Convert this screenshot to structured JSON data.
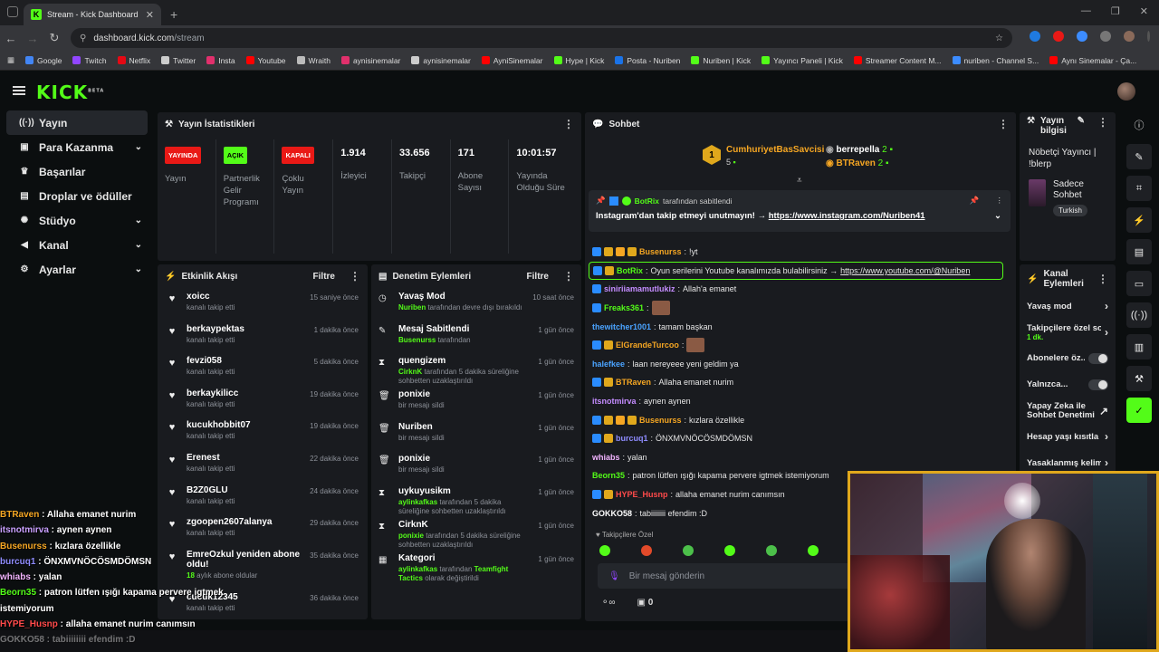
{
  "browser": {
    "tab_title": "Stream - Kick Dashboard",
    "tab_favicon": "K",
    "url_host": "dashboard.kick.com",
    "url_path": "/stream",
    "bookmarks": [
      {
        "label": "Google",
        "color": "#4285f4"
      },
      {
        "label": "Twitch",
        "color": "#9146ff"
      },
      {
        "label": "Netflix",
        "color": "#e50914"
      },
      {
        "label": "Twitter",
        "color": "#cccccc"
      },
      {
        "label": "Insta",
        "color": "#e1306c"
      },
      {
        "label": "Youtube",
        "color": "#ff0000"
      },
      {
        "label": "Wraith",
        "color": "#bbbbbb"
      },
      {
        "label": "aynisinemalar",
        "color": "#e1306c"
      },
      {
        "label": "aynisinemalar",
        "color": "#cccccc"
      },
      {
        "label": "AyniSinemalar",
        "color": "#ff0000"
      },
      {
        "label": "Hype | Kick",
        "color": "#53fc18"
      },
      {
        "label": "Posta - Nuriben",
        "color": "#1a73e8"
      },
      {
        "label": "Nuriben | Kick",
        "color": "#53fc18"
      },
      {
        "label": "Yayıncı Paneli | Kick",
        "color": "#53fc18"
      },
      {
        "label": "Streamer Content M...",
        "color": "#ff0000"
      },
      {
        "label": "nuriben - Channel S...",
        "color": "#3c8cff"
      },
      {
        "label": "Aynı Sinemalar - Ça...",
        "color": "#ff0000"
      }
    ]
  },
  "brand": {
    "logo": "KICK",
    "logo_sup": "BETA",
    "accent": "#53fc18"
  },
  "sidebar": {
    "items": [
      {
        "label": "Yayın",
        "icon": "broadcast-icon",
        "glyph": "((·))"
      },
      {
        "label": "Para Kazanma",
        "icon": "money-icon",
        "glyph": "▣"
      },
      {
        "label": "Başarılar",
        "icon": "trophy-icon",
        "glyph": "♛"
      },
      {
        "label": "Droplar ve ödüller",
        "icon": "gift-icon",
        "glyph": "▤"
      },
      {
        "label": "Stüdyo",
        "icon": "studio-icon",
        "glyph": "✺"
      },
      {
        "label": "Kanal",
        "icon": "channel-icon",
        "glyph": "◀"
      },
      {
        "label": "Ayarlar",
        "icon": "settings-icon",
        "glyph": "⚙"
      }
    ]
  },
  "stats": {
    "title": "Yayın İstatistikleri",
    "cells": [
      {
        "badge": "YAYINDA",
        "label": "Yayın"
      },
      {
        "badge": "AÇIK",
        "label": "Partnerlik Gelir Programı"
      },
      {
        "badge": "KAPALI",
        "label": "Çoklu Yayın"
      },
      {
        "value": "1.914",
        "label": "İzleyici"
      },
      {
        "value": "33.656",
        "label": "Takipçi"
      },
      {
        "value": "171",
        "label": "Abone Sayısı"
      },
      {
        "value": "10:01:57",
        "label": "Yayında Olduğu Süre"
      }
    ]
  },
  "activity": {
    "title": "Etkinlik Akışı",
    "filter": "Filtre",
    "items": [
      {
        "name": "xoicc",
        "sub": "kanalı takip etti",
        "time": "15 saniye önce"
      },
      {
        "name": "berkaypektas",
        "sub": "kanalı takip etti",
        "time": "1 dakika önce"
      },
      {
        "name": "fevzi058",
        "sub": "kanalı takip etti",
        "time": "5 dakika önce"
      },
      {
        "name": "berkaykilicc",
        "sub": "kanalı takip etti",
        "time": "19 dakika önce"
      },
      {
        "name": "kucukhobbit07",
        "sub": "kanalı takip etti",
        "time": "19 dakika önce"
      },
      {
        "name": "Erenest",
        "sub": "kanalı takip etti",
        "time": "22 dakika önce"
      },
      {
        "name": "B2Z0GLU",
        "sub": "kanalı takip etti",
        "time": "24 dakika önce"
      },
      {
        "name": "zgoopen2607alanya",
        "sub": "kanalı takip etti",
        "time": "29 dakika önce"
      },
      {
        "name": "EmreOzkul yeniden abone oldu!",
        "sub_hl": "18",
        "sub": " aylık abone oldular",
        "time": "35 dakika önce"
      },
      {
        "name": "cucuk12345",
        "sub": "kanalı takip etti",
        "time": "36 dakika önce"
      }
    ]
  },
  "audit": {
    "title": "Denetim Eylemleri",
    "filter": "Filtre",
    "items": [
      {
        "title": "Yavaş Mod",
        "glyph": "◷",
        "actor": "Nuriben",
        "rest": " tarafından devre dışı bırakıldı",
        "time": "10 saat önce"
      },
      {
        "title": "Mesaj Sabitlendi",
        "glyph": "✎",
        "actor": "Busenurss",
        "rest": " tarafından",
        "time": "1 gün önce"
      },
      {
        "title": "quengizem",
        "glyph": "⧗",
        "actor": "CirknK",
        "rest": " tarafından 5 dakika süreliğine sohbetten uzaklaştırıldı",
        "time": "1 gün önce"
      },
      {
        "title": "ponixie",
        "glyph": "🗑",
        "actor": "",
        "rest": "bir mesajı sildi",
        "time": "1 gün önce"
      },
      {
        "title": "Nuriben",
        "glyph": "🗑",
        "actor": "",
        "rest": "bir mesajı sildi",
        "time": "1 gün önce"
      },
      {
        "title": "ponixie",
        "glyph": "🗑",
        "actor": "",
        "rest": "bir mesajı sildi",
        "time": "1 gün önce"
      },
      {
        "title": "uykuyusikm",
        "glyph": "⧗",
        "actor": "aylinkafkas",
        "rest": " tarafından 5 dakika süreliğine sohbetten uzaklaştırıldı",
        "time": "1 gün önce"
      },
      {
        "title": "CirknK",
        "glyph": "⧗",
        "actor": "ponixie",
        "rest": " tarafından 5 dakika süreliğine sohbetten uzaklaştırıldı",
        "time": "1 gün önce"
      },
      {
        "title": "Kategori",
        "glyph": "▦",
        "actor": "aylinkafkas",
        "rest": " tarafından ",
        "rest_hl": "Teamfight Tactics",
        "rest2": " olarak değiştirildi",
        "time": "1 gün önce"
      }
    ]
  },
  "chat": {
    "title": "Sohbet",
    "top": [
      {
        "rank": "1",
        "name": "CumhuriyetBasSavcisi",
        "count": "5",
        "color": "#f5a623"
      },
      {
        "rank": "",
        "name": "berrepella",
        "count": "2",
        "color": "#ffffff"
      },
      {
        "rank": "",
        "name": "BTRaven",
        "count": "2",
        "color": "#f5a623"
      }
    ],
    "pinned_by": "BotRix",
    "pinned_suffix": "tarafından sabitlendi",
    "pinned_msg": "Instagram'dan takip etmeyi unutmayın! → ",
    "pinned_link": "https://www.instagram.com/Nuriben41",
    "messages": [
      {
        "user": "Busenurss",
        "color": "#f5a623",
        "text": "!yt",
        "badges": 4
      },
      {
        "user": "BotRix",
        "color": "#53fc18",
        "text": "Oyun serilerini Youtube kanalımızda bulabilirsiniz → ",
        "link": "https://www.youtube.com/@Nuriben",
        "badges": 2,
        "hl": true
      },
      {
        "user": "siniriiamamutlukiz",
        "color": "#c48cff",
        "text": "Allah'a emanet",
        "badges": 1
      },
      {
        "user": "Freaks361",
        "color": "#53fc18",
        "text": "",
        "badges": 1,
        "emote": true
      },
      {
        "user": "thewitcher1001",
        "color": "#4aa3ff",
        "text": "tamam başkan",
        "badges": 0
      },
      {
        "user": "ElGrandeTurcoo",
        "color": "#f5a623",
        "text": "",
        "badges": 2,
        "emote": true
      },
      {
        "user": "halefkee",
        "color": "#4aa3ff",
        "text": "laan nereyeee yeni geldim ya",
        "badges": 0
      },
      {
        "user": "BTRaven",
        "color": "#f5a623",
        "text": "Allaha emanet nurim",
        "badges": 2
      },
      {
        "user": "itsnotmirva",
        "color": "#c48cff",
        "text": "aynen aynen",
        "badges": 0
      },
      {
        "user": "Busenurss",
        "color": "#f5a623",
        "text": "kızlara özellikle",
        "badges": 4
      },
      {
        "user": "burcuq1",
        "color": "#8f8cff",
        "text": "ÖNXMVNÖCÖSMDÖMSN",
        "badges": 2
      },
      {
        "user": "whiabs",
        "color": "#f2b4ff",
        "text": "yalan",
        "badges": 0
      },
      {
        "user": "Beorn35",
        "color": "#53fc18",
        "text": "patron lütfen ışığı kapama pervere igtmek istemiyorum",
        "badges": 0
      },
      {
        "user": "HYPE_Husnp",
        "color": "#ff4a4a",
        "text": "allaha emanet nurim canımsın",
        "badges": 2
      },
      {
        "user": "GOKKO58",
        "color": "#ffffff",
        "text": "tabiiiiiiii efendim :D",
        "badges": 0
      }
    ],
    "followers_only": "Takipçilere Özel",
    "input_placeholder": "Bir mesaj gönderin",
    "footer_count": "0"
  },
  "stream_info": {
    "title": "Yayın bilgisi",
    "text": "Nöbetçi Yayıncı | !blerp",
    "category": "Sadece Sohbet",
    "language": "Turkish"
  },
  "channel_actions": {
    "title": "Kanal Eylemleri",
    "items": [
      {
        "label": "Yavaş mod",
        "type": "chevron"
      },
      {
        "label": "Takipçilere özel so",
        "sub": "1 dk.",
        "type": "chevron"
      },
      {
        "label": "Abonelere öz...",
        "type": "toggle"
      },
      {
        "label": "Yalnızca...",
        "type": "toggle"
      },
      {
        "label": "Yapay Zeka ile Sohbet Denetimi",
        "type": "external"
      },
      {
        "label": "Hesap yaşı kısıtla",
        "type": "chevron"
      },
      {
        "label": "Yasaklanmış kelim",
        "type": "chevron"
      }
    ]
  },
  "overlay_chat": [
    {
      "user": "BTRaven",
      "cls": "bt",
      "text": " : Allaha emanet nurim"
    },
    {
      "user": "itsnotmirva",
      "cls": "it",
      "text": " : aynen aynen"
    },
    {
      "user": "Busenurss",
      "cls": "bt",
      "text": " : kızlara özellikle"
    },
    {
      "user": "burcuq1",
      "cls": "pu",
      "text": " : ÖNXMVNÖCÖSMDÖMSN"
    },
    {
      "user": "whiabs",
      "cls": "wh",
      "text": " : yalan"
    },
    {
      "user": "Beorn35",
      "cls": "be",
      "text": " : patron lütfen ışığı kapama pervere igtmek istemiyorum"
    },
    {
      "user": "HYPE_Husnp",
      "cls": "hy",
      "text": " : allaha emanet nurim canımsın"
    },
    {
      "user": "GOKKO58",
      "cls": "",
      "text": " : tabiiiiiiii efendim :D"
    }
  ]
}
